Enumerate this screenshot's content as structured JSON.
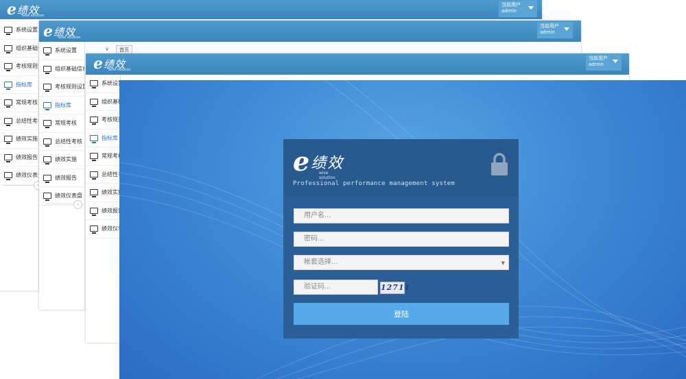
{
  "brand": {
    "e": "e",
    "name": "绩效",
    "sub": "wise solution"
  },
  "user": {
    "current_label": "当前用户",
    "name": "admin"
  },
  "back_window": {
    "menu": [
      "系统设置",
      "组织基础信",
      "考核规则设",
      "指标库",
      "常规考核",
      "总结性考核",
      "绩效实施",
      "绩效报告",
      "绩效仪表盘"
    ],
    "active_index": 3
  },
  "mid_window": {
    "menu": [
      "系统设置",
      "组织基础信息",
      "考核规则设置",
      "指标库",
      "常规考核",
      "总结性考核",
      "绩效实施",
      "绩效报告",
      "绩效仪表盘"
    ],
    "active_index": 3,
    "tab_label": "首页"
  },
  "front_window": {
    "menu": [
      "系统设置",
      "组织基础信息",
      "考核规则设置",
      "指标库",
      "常规考核",
      "总结性考核",
      "绩效实施",
      "绩效报告",
      "绩效仪表盘"
    ],
    "active_index": 3
  },
  "login": {
    "tagline": "Professional performance management system",
    "username_placeholder": "用户名...",
    "password_placeholder": "密码...",
    "account_select": "帐套选择...",
    "captcha_placeholder": "验证码...",
    "captcha_text": "12711",
    "submit_label": "登陆"
  },
  "colors": {
    "header": "#3a86bd",
    "active_menu": "#2c73b8",
    "login_bg": "#3e8ad6",
    "panel": "#2c5f96",
    "button": "#56aaea"
  }
}
